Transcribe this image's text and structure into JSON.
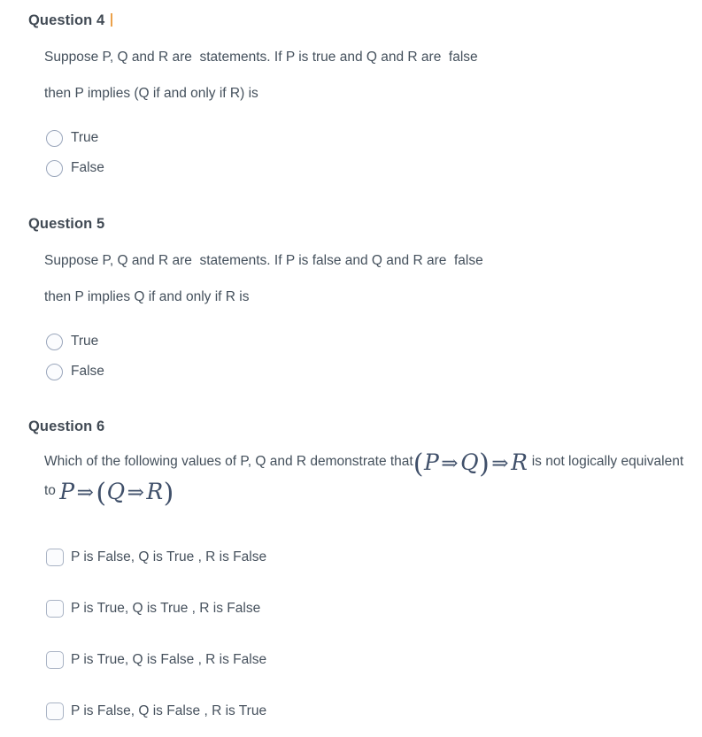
{
  "questions": [
    {
      "heading": "Question 4",
      "has_caret": true,
      "prompt_lines": [
        "Suppose P, Q and R are  statements. If P is true and Q and R are  false",
        "then P implies (Q if and only if R) is"
      ],
      "input_type": "radio",
      "options": [
        "True",
        "False"
      ]
    },
    {
      "heading": "Question 5",
      "has_caret": false,
      "prompt_lines": [
        "Suppose P, Q and R are  statements. If P is false and Q and R are  false",
        "then P implies Q if and only if R is"
      ],
      "input_type": "radio",
      "options": [
        "True",
        "False"
      ]
    },
    {
      "heading": "Question 6",
      "has_caret": false,
      "prompt_rich": {
        "text_1": "Which of the following values of P, Q and R demonstrate that",
        "math_1": "(P ⇒ Q) ⇒ R",
        "text_2": " is not logically equivalent  to ",
        "math_2": "P ⇒ (Q ⇒ R)"
      },
      "input_type": "checkbox",
      "options": [
        "P is False, Q is True , R is False",
        "P is True, Q is True , R is False",
        "P is True, Q is False , R is False",
        "P is False, Q is False , R is True"
      ]
    }
  ],
  "math_parts": {
    "m1": {
      "a": "(",
      "p": "P",
      "op1": "⇒",
      "q": "Q",
      "b": ")",
      "op2": "⇒",
      "r": "R"
    },
    "m2": {
      "p": "P",
      "op1": "⇒",
      "a": "(",
      "q": "Q",
      "op2": "⇒",
      "r": "R",
      "b": ")"
    }
  },
  "colors": {
    "heading": "#414a54",
    "body": "#44505c",
    "math": "#40506a",
    "caret": "#e8912a",
    "control_border": "#9aa6bb",
    "background": "#ffffff"
  }
}
